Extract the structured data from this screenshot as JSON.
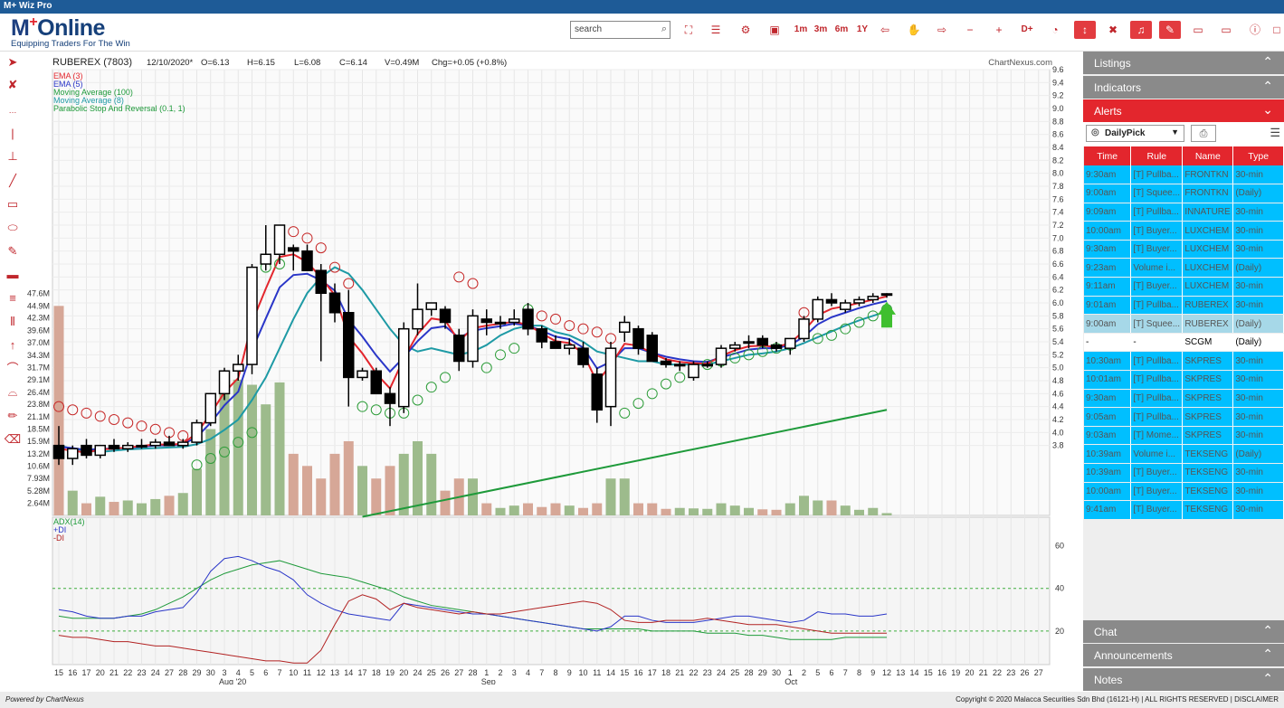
{
  "app": {
    "title": "M+ Wiz Pro",
    "logo_main": "Online",
    "logo_prefix": "M",
    "logo_tagline": "Equipping Traders For The Win"
  },
  "toolbar": {
    "search_placeholder": "search",
    "intervals": [
      "1m",
      "3m",
      "6m",
      "1Y"
    ],
    "other": [
      "D+"
    ]
  },
  "chart": {
    "symbol": "RUBEREX (7803)",
    "date": "12/10/2020*",
    "open": "O=6.13",
    "high": "H=6.15",
    "low": "L=6.08",
    "close": "C=6.14",
    "volume": "V=0.49M",
    "change": "Chg=+0.05 (+0.8%)",
    "watermark": "ChartNexus.com",
    "legend": [
      {
        "label": "EMA (3)",
        "color": "#e3262d"
      },
      {
        "label": "EMA (5)",
        "color": "#2a36c8"
      },
      {
        "label": "Moving Average (100)",
        "color": "#1e9a3a"
      },
      {
        "label": "Moving Average (8)",
        "color": "#1e9aa5"
      },
      {
        "label": "Parabolic Stop And Reversal (0.1, 1)",
        "color": "#1e9a3a"
      }
    ],
    "price_axis": [
      "9.6",
      "9.4",
      "9.2",
      "9.0",
      "8.8",
      "8.6",
      "8.4",
      "8.2",
      "8.0",
      "7.8",
      "7.6",
      "7.4",
      "7.2",
      "7.0",
      "6.8",
      "6.6",
      "6.4",
      "6.2",
      "6.0",
      "5.8",
      "5.6",
      "5.4",
      "5.2",
      "5.0",
      "4.8",
      "4.6",
      "4.4",
      "4.2",
      "4.0",
      "3.8"
    ],
    "volume_axis": [
      "47.6M",
      "44.9M",
      "42.3M",
      "39.6M",
      "37.0M",
      "34.3M",
      "31.7M",
      "29.1M",
      "26.4M",
      "23.8M",
      "21.1M",
      "18.5M",
      "15.9M",
      "13.2M",
      "10.6M",
      "7.93M",
      "5.28M",
      "2.64M"
    ],
    "adx_legend": [
      {
        "label": "ADX(14)",
        "color": "#1e9a3a"
      },
      {
        "label": "+DI",
        "color": "#2a36c8"
      },
      {
        "label": "-DI",
        "color": "#b22222"
      }
    ],
    "adx_axis": [
      "60",
      "40",
      "20"
    ],
    "x_labels": [
      "15",
      "16",
      "17",
      "20",
      "21",
      "22",
      "23",
      "24",
      "27",
      "28",
      "29",
      "30",
      "3",
      "4",
      "5",
      "6",
      "7",
      "10",
      "11",
      "12",
      "13",
      "14",
      "17",
      "18",
      "19",
      "20",
      "24",
      "25",
      "26",
      "27",
      "28",
      "1",
      "2",
      "3",
      "4",
      "7",
      "8",
      "9",
      "10",
      "11",
      "14",
      "15",
      "16",
      "17",
      "18",
      "21",
      "22",
      "23",
      "24",
      "25",
      "28",
      "29",
      "30",
      "1",
      "2",
      "5",
      "6",
      "7",
      "8",
      "9",
      "12",
      "13",
      "14",
      "15",
      "16",
      "19",
      "20",
      "21",
      "22",
      "23",
      "26",
      "27"
    ],
    "month_labels": [
      {
        "label": "Aug '20",
        "index": 12
      },
      {
        "label": "Sep",
        "index": 31
      },
      {
        "label": "Oct",
        "index": 53
      }
    ]
  },
  "chart_data": {
    "type": "candlestick",
    "title": "RUBEREX (7803)",
    "ylim": [
      3.6,
      9.6
    ],
    "candles": [
      {
        "o": 3.8,
        "h": 4.1,
        "l": 3.5,
        "c": 3.6
      },
      {
        "o": 3.6,
        "h": 3.8,
        "l": 3.5,
        "c": 3.75
      },
      {
        "o": 3.8,
        "h": 3.9,
        "l": 3.6,
        "c": 3.65
      },
      {
        "o": 3.65,
        "h": 3.8,
        "l": 3.6,
        "c": 3.8
      },
      {
        "o": 3.8,
        "h": 3.9,
        "l": 3.7,
        "c": 3.75
      },
      {
        "o": 3.75,
        "h": 3.85,
        "l": 3.7,
        "c": 3.8
      },
      {
        "o": 3.8,
        "h": 3.9,
        "l": 3.75,
        "c": 3.8
      },
      {
        "o": 3.8,
        "h": 3.9,
        "l": 3.75,
        "c": 3.85
      },
      {
        "o": 3.85,
        "h": 3.95,
        "l": 3.8,
        "c": 3.8
      },
      {
        "o": 3.8,
        "h": 3.9,
        "l": 3.75,
        "c": 3.85
      },
      {
        "o": 3.85,
        "h": 4.2,
        "l": 3.8,
        "c": 4.15
      },
      {
        "o": 4.15,
        "h": 4.6,
        "l": 4.1,
        "c": 4.6
      },
      {
        "o": 4.6,
        "h": 5.0,
        "l": 4.5,
        "c": 4.95
      },
      {
        "o": 4.95,
        "h": 5.2,
        "l": 4.8,
        "c": 5.05
      },
      {
        "o": 5.05,
        "h": 6.6,
        "l": 4.9,
        "c": 6.55
      },
      {
        "o": 6.6,
        "h": 7.2,
        "l": 6.5,
        "c": 6.75
      },
      {
        "o": 6.75,
        "h": 7.2,
        "l": 6.6,
        "c": 7.2
      },
      {
        "o": 6.85,
        "h": 6.9,
        "l": 6.5,
        "c": 6.8
      },
      {
        "o": 6.8,
        "h": 6.9,
        "l": 6.5,
        "c": 6.5
      },
      {
        "o": 6.5,
        "h": 6.6,
        "l": 5.1,
        "c": 6.15
      },
      {
        "o": 6.15,
        "h": 6.3,
        "l": 5.7,
        "c": 5.85
      },
      {
        "o": 5.85,
        "h": 6.2,
        "l": 4.4,
        "c": 4.85
      },
      {
        "o": 4.85,
        "h": 5.0,
        "l": 4.8,
        "c": 4.95
      },
      {
        "o": 4.95,
        "h": 5.0,
        "l": 4.6,
        "c": 4.6
      },
      {
        "o": 4.6,
        "h": 4.7,
        "l": 4.1,
        "c": 4.45
      },
      {
        "o": 4.4,
        "h": 5.7,
        "l": 4.3,
        "c": 5.6
      },
      {
        "o": 5.6,
        "h": 6.3,
        "l": 5.5,
        "c": 5.9
      },
      {
        "o": 5.9,
        "h": 6.0,
        "l": 5.8,
        "c": 6.0
      },
      {
        "o": 5.9,
        "h": 5.95,
        "l": 5.6,
        "c": 5.7
      },
      {
        "o": 5.5,
        "h": 5.6,
        "l": 4.95,
        "c": 5.1
      },
      {
        "o": 5.1,
        "h": 5.9,
        "l": 5.0,
        "c": 5.8
      },
      {
        "o": 5.75,
        "h": 5.9,
        "l": 5.5,
        "c": 5.7
      },
      {
        "o": 5.7,
        "h": 5.8,
        "l": 5.6,
        "c": 5.7
      },
      {
        "o": 5.7,
        "h": 5.9,
        "l": 5.65,
        "c": 5.75
      },
      {
        "o": 5.9,
        "h": 6.0,
        "l": 5.5,
        "c": 5.6
      },
      {
        "o": 5.6,
        "h": 5.65,
        "l": 5.3,
        "c": 5.4
      },
      {
        "o": 5.4,
        "h": 5.5,
        "l": 5.3,
        "c": 5.3
      },
      {
        "o": 5.3,
        "h": 5.45,
        "l": 5.2,
        "c": 5.35
      },
      {
        "o": 5.3,
        "h": 5.4,
        "l": 5.0,
        "c": 5.05
      },
      {
        "o": 4.9,
        "h": 5.0,
        "l": 4.15,
        "c": 4.35
      },
      {
        "o": 4.4,
        "h": 5.4,
        "l": 4.1,
        "c": 5.3
      },
      {
        "o": 5.55,
        "h": 5.8,
        "l": 5.4,
        "c": 5.7
      },
      {
        "o": 5.6,
        "h": 5.65,
        "l": 5.2,
        "c": 5.3
      },
      {
        "o": 5.5,
        "h": 5.55,
        "l": 5.1,
        "c": 5.1
      },
      {
        "o": 5.1,
        "h": 5.15,
        "l": 5.0,
        "c": 5.05
      },
      {
        "o": 5.05,
        "h": 5.1,
        "l": 4.95,
        "c": 5.05
      },
      {
        "o": 4.85,
        "h": 5.1,
        "l": 4.8,
        "c": 5.05
      },
      {
        "o": 5.05,
        "h": 5.1,
        "l": 5.0,
        "c": 5.05
      },
      {
        "o": 5.05,
        "h": 5.35,
        "l": 5.0,
        "c": 5.3
      },
      {
        "o": 5.3,
        "h": 5.4,
        "l": 5.25,
        "c": 5.35
      },
      {
        "o": 5.4,
        "h": 5.5,
        "l": 5.3,
        "c": 5.4
      },
      {
        "o": 5.45,
        "h": 5.5,
        "l": 5.3,
        "c": 5.35
      },
      {
        "o": 5.35,
        "h": 5.4,
        "l": 5.25,
        "c": 5.3
      },
      {
        "o": 5.3,
        "h": 5.45,
        "l": 5.2,
        "c": 5.45
      },
      {
        "o": 5.45,
        "h": 5.8,
        "l": 5.4,
        "c": 5.75
      },
      {
        "o": 5.75,
        "h": 6.1,
        "l": 5.7,
        "c": 6.05
      },
      {
        "o": 6.05,
        "h": 6.15,
        "l": 5.95,
        "c": 6.0
      },
      {
        "o": 5.9,
        "h": 6.05,
        "l": 5.85,
        "c": 6.0
      },
      {
        "o": 6.0,
        "h": 6.1,
        "l": 5.95,
        "c": 6.05
      },
      {
        "o": 6.05,
        "h": 6.15,
        "l": 6.0,
        "c": 6.1
      },
      {
        "o": 6.13,
        "h": 6.15,
        "l": 6.08,
        "c": 6.14
      }
    ],
    "volume_millions": [
      44.9,
      5.3,
      2.6,
      4.0,
      2.9,
      3.2,
      2.6,
      3.5,
      4.2,
      4.8,
      10.0,
      18.5,
      29.1,
      29.1,
      28.0,
      23.8,
      28.5,
      13.2,
      10.6,
      7.9,
      13.2,
      15.9,
      10.6,
      7.9,
      10.6,
      13.2,
      15.9,
      13.2,
      5.3,
      7.9,
      7.9,
      2.6,
      1.6,
      2.1,
      2.6,
      1.8,
      2.6,
      2.1,
      1.6,
      2.6,
      7.9,
      7.9,
      2.6,
      2.6,
      1.4,
      1.6,
      1.5,
      1.4,
      2.6,
      2.1,
      1.6,
      1.3,
      1.2,
      2.6,
      4.2,
      3.2,
      3.2,
      2.1,
      1.2,
      1.6,
      0.49
    ],
    "ema3": [
      3.75,
      3.72,
      3.69,
      3.74,
      3.75,
      3.77,
      3.79,
      3.82,
      3.81,
      3.83,
      3.99,
      4.29,
      4.62,
      4.84,
      5.7,
      6.22,
      6.71,
      6.75,
      6.63,
      6.39,
      6.12,
      5.48,
      5.22,
      4.91,
      4.68,
      5.14,
      5.52,
      5.76,
      5.73,
      5.41,
      5.61,
      5.65,
      5.68,
      5.71,
      5.66,
      5.53,
      5.41,
      5.38,
      5.22,
      4.78,
      5.04,
      5.37,
      5.34,
      5.22,
      5.13,
      5.09,
      5.07,
      5.06,
      5.18,
      5.27,
      5.33,
      5.34,
      5.32,
      5.38,
      5.57,
      5.81,
      5.91,
      5.95,
      6.0,
      6.05,
      6.1
    ],
    "ema5": [
      3.78,
      3.76,
      3.73,
      3.75,
      3.75,
      3.77,
      3.78,
      3.8,
      3.8,
      3.82,
      3.93,
      4.15,
      4.42,
      4.63,
      5.27,
      5.76,
      6.24,
      6.43,
      6.45,
      6.35,
      6.19,
      5.74,
      5.48,
      5.19,
      4.94,
      5.16,
      5.41,
      5.61,
      5.64,
      5.46,
      5.57,
      5.61,
      5.64,
      5.68,
      5.65,
      5.57,
      5.48,
      5.44,
      5.31,
      4.99,
      5.09,
      5.3,
      5.3,
      5.23,
      5.17,
      5.13,
      5.1,
      5.09,
      5.16,
      5.22,
      5.28,
      5.3,
      5.3,
      5.35,
      5.48,
      5.67,
      5.78,
      5.85,
      5.92,
      5.98,
      6.03
    ],
    "ma8": [
      3.8,
      3.75,
      3.72,
      3.7,
      3.72,
      3.74,
      3.75,
      3.76,
      3.77,
      3.78,
      3.82,
      3.9,
      4.04,
      4.2,
      4.5,
      4.85,
      5.3,
      5.75,
      6.15,
      6.4,
      6.55,
      6.45,
      6.2,
      5.9,
      5.6,
      5.35,
      5.25,
      5.3,
      5.25,
      5.2,
      5.25,
      5.35,
      5.5,
      5.6,
      5.65,
      5.65,
      5.55,
      5.5,
      5.4,
      5.25,
      5.2,
      5.15,
      5.1,
      5.1,
      5.05,
      5.05,
      5.05,
      5.05,
      5.1,
      5.15,
      5.2,
      5.22,
      5.25,
      5.3,
      5.38,
      5.47,
      5.56,
      5.65,
      5.73,
      5.8,
      5.87
    ],
    "sar": [
      4.4,
      4.35,
      4.3,
      4.25,
      4.2,
      4.15,
      4.1,
      4.05,
      4.0,
      3.95,
      3.5,
      3.6,
      3.7,
      3.85,
      4.0,
      6.55,
      6.6,
      7.1,
      7.0,
      6.85,
      6.55,
      6.3,
      4.4,
      4.35,
      4.3,
      4.3,
      4.5,
      4.7,
      4.85,
      6.4,
      6.3,
      5.0,
      5.2,
      5.3,
      5.9,
      5.8,
      5.75,
      5.65,
      5.6,
      5.55,
      5.45,
      4.3,
      4.45,
      4.6,
      4.75,
      4.85,
      4.95,
      5.05,
      5.1,
      5.15,
      5.2,
      5.25,
      5.3,
      5.35,
      5.85,
      5.45,
      5.5,
      5.6,
      5.7,
      5.8,
      5.9
    ],
    "ma100": [
      [
        22,
        2.7
      ],
      [
        60,
        4.35
      ]
    ],
    "adx": [
      27,
      26,
      26,
      26,
      26,
      27,
      28,
      30,
      33,
      36,
      40,
      44,
      47,
      49,
      51,
      52,
      53,
      51,
      49,
      47,
      46,
      45,
      43,
      41,
      39,
      36,
      34,
      32,
      31,
      30,
      29,
      28,
      27,
      26,
      25,
      24,
      23,
      22,
      21,
      21,
      21,
      21,
      21,
      20,
      20,
      20,
      20,
      19,
      19,
      19,
      18,
      18,
      17,
      16,
      16,
      16,
      16,
      17,
      17,
      17,
      17
    ],
    "plus_di": [
      30,
      29,
      27,
      26,
      26,
      27,
      27,
      29,
      30,
      31,
      38,
      48,
      54,
      55,
      53,
      50,
      48,
      44,
      37,
      33,
      30,
      28,
      27,
      26,
      25,
      33,
      32,
      31,
      30,
      29,
      28,
      28,
      27,
      26,
      25,
      24,
      23,
      22,
      21,
      20,
      22,
      27,
      27,
      25,
      24,
      24,
      24,
      25,
      26,
      27,
      27,
      26,
      25,
      24,
      25,
      29,
      28,
      28,
      27,
      27,
      28
    ],
    "minus_di": [
      18,
      17,
      17,
      16,
      15,
      15,
      14,
      13,
      13,
      12,
      11,
      10,
      9,
      8,
      7,
      6,
      6,
      5,
      5,
      11,
      23,
      34,
      37,
      35,
      30,
      33,
      31,
      30,
      29,
      28,
      29,
      28,
      28,
      29,
      30,
      31,
      32,
      33,
      34,
      33,
      30,
      25,
      24,
      24,
      25,
      25,
      25,
      26,
      25,
      24,
      23,
      23,
      23,
      22,
      21,
      20,
      19,
      19,
      19,
      19,
      19
    ],
    "adx_ylim": [
      0,
      70
    ]
  },
  "right_panel": {
    "sections": {
      "listings": "Listings",
      "indicators": "Indicators",
      "alerts": "Alerts",
      "chat": "Chat",
      "announcements": "Announcements",
      "notes": "Notes"
    },
    "alert_filter": "DailyPick",
    "alert_columns": [
      "Time",
      "Rule",
      "Name",
      "Type"
    ],
    "alerts": [
      {
        "time": "9:30am",
        "rule": "[T] Pullba...",
        "name": "FRONTKN",
        "type": "30-min",
        "style": "cyan"
      },
      {
        "time": "9:00am",
        "rule": "[T] Squee...",
        "name": "FRONTKN",
        "type": "(Daily)",
        "style": "cyan"
      },
      {
        "time": "9:09am",
        "rule": "[T] Pullba...",
        "name": "INNATURE",
        "type": "30-min",
        "style": "cyan"
      },
      {
        "time": "10:00am",
        "rule": "[T] Buyer...",
        "name": "LUXCHEM",
        "type": "30-min",
        "style": "cyan"
      },
      {
        "time": "9:30am",
        "rule": "[T] Buyer...",
        "name": "LUXCHEM",
        "type": "30-min",
        "style": "cyan"
      },
      {
        "time": "9:23am",
        "rule": "Volume i...",
        "name": "LUXCHEM",
        "type": "(Daily)",
        "style": "cyan"
      },
      {
        "time": "9:11am",
        "rule": "[T] Buyer...",
        "name": "LUXCHEM",
        "type": "30-min",
        "style": "cyan"
      },
      {
        "time": "9:01am",
        "rule": "[T] Pullba...",
        "name": "RUBEREX",
        "type": "30-min",
        "style": "cyan"
      },
      {
        "time": "9:00am",
        "rule": "[T] Squee...",
        "name": "RUBEREX",
        "type": "(Daily)",
        "style": "sel"
      },
      {
        "time": "-",
        "rule": "-",
        "name": "SCGM",
        "type": "(Daily)",
        "style": "white"
      },
      {
        "time": "10:30am",
        "rule": "[T] Pullba...",
        "name": "SKPRES",
        "type": "30-min",
        "style": "cyan"
      },
      {
        "time": "10:01am",
        "rule": "[T] Pullba...",
        "name": "SKPRES",
        "type": "30-min",
        "style": "cyan"
      },
      {
        "time": "9:30am",
        "rule": "[T] Pullba...",
        "name": "SKPRES",
        "type": "30-min",
        "style": "cyan"
      },
      {
        "time": "9:05am",
        "rule": "[T] Pullba...",
        "name": "SKPRES",
        "type": "30-min",
        "style": "cyan"
      },
      {
        "time": "9:03am",
        "rule": "[T] Mome...",
        "name": "SKPRES",
        "type": "30-min",
        "style": "cyan"
      },
      {
        "time": "10:39am",
        "rule": "Volume i...",
        "name": "TEKSENG",
        "type": "(Daily)",
        "style": "cyan"
      },
      {
        "time": "10:39am",
        "rule": "[T] Buyer...",
        "name": "TEKSENG",
        "type": "30-min",
        "style": "cyan"
      },
      {
        "time": "10:00am",
        "rule": "[T] Buyer...",
        "name": "TEKSENG",
        "type": "30-min",
        "style": "cyan"
      },
      {
        "time": "9:41am",
        "rule": "[T] Buyer...",
        "name": "TEKSENG",
        "type": "30-min",
        "style": "cyan"
      }
    ]
  },
  "status": {
    "powered": "Powered by ChartNexus",
    "copyright": "Copyright © 2020 Malacca Securities Sdn Bhd (16121-H)   |   ALL RIGHTS RESERVED   |   DISCLAIMER"
  }
}
